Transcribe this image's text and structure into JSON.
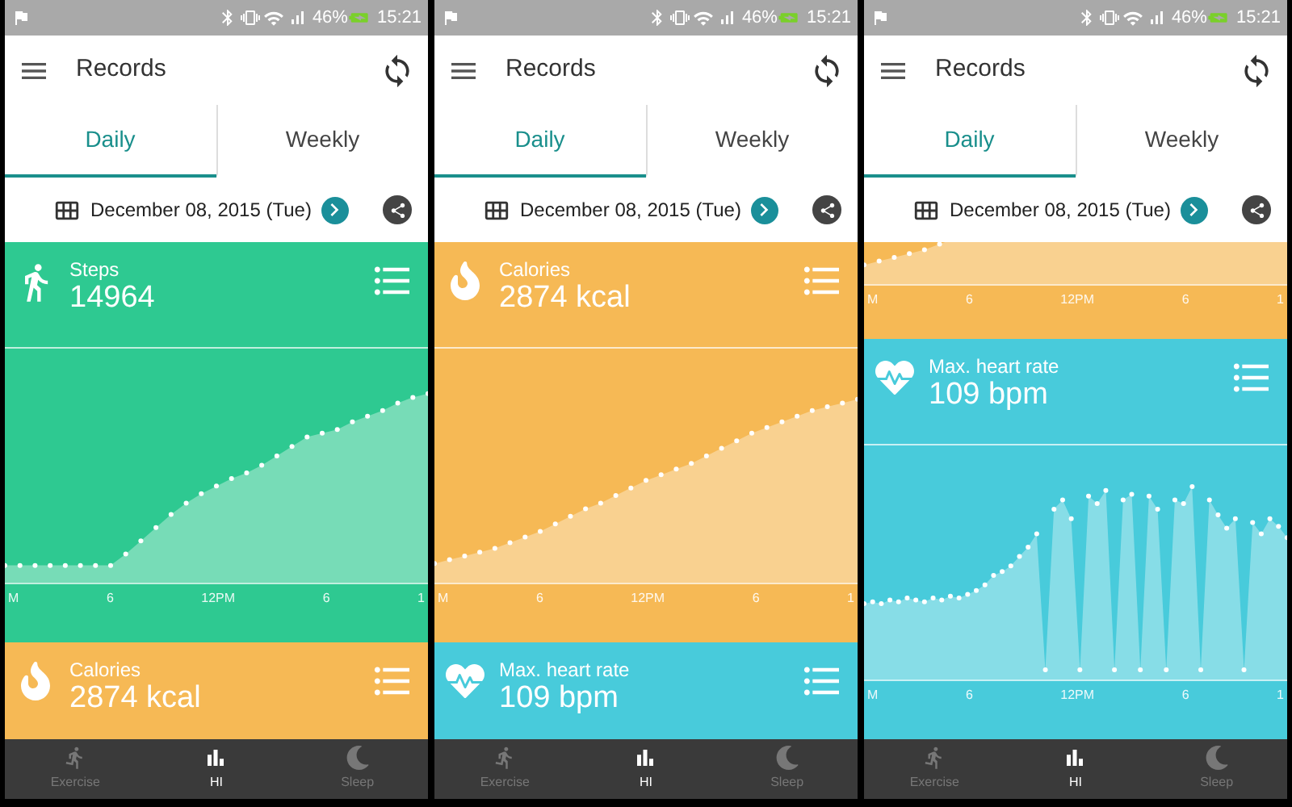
{
  "phones": [
    {
      "status_bar": {
        "battery": "46%",
        "time": "15:21"
      },
      "title": "Records",
      "tabs": [
        {
          "label": "Daily",
          "selected": true
        },
        {
          "label": "Weekly",
          "selected": false
        }
      ],
      "date": "December 08, 2015 (Tue)",
      "cards": [
        {
          "kind": "steps",
          "label": "Steps",
          "value": "14964",
          "color": "#2ec991",
          "x_labels": [
            "M",
            "6",
            "12PM",
            "6",
            "1"
          ]
        },
        {
          "kind": "calories",
          "label": "Calories",
          "value": "2874 kcal",
          "color": "#f6b955"
        }
      ],
      "nav": [
        {
          "kind": "exercise",
          "label": "Exercise",
          "selected": false
        },
        {
          "kind": "stats",
          "label": "HI",
          "selected": true
        },
        {
          "kind": "sleep",
          "label": "Sleep",
          "selected": false
        }
      ]
    },
    {
      "status_bar": {
        "battery": "46%",
        "time": "15:21"
      },
      "title": "Records",
      "tabs": [
        {
          "label": "Daily",
          "selected": true
        },
        {
          "label": "Weekly",
          "selected": false
        }
      ],
      "date": "December 08, 2015 (Tue)",
      "cards": [
        {
          "kind": "calories",
          "label": "Calories",
          "value": "2874 kcal",
          "color": "#f6b955",
          "x_labels": [
            "M",
            "6",
            "12PM",
            "6",
            "1"
          ]
        },
        {
          "kind": "heart",
          "label": "Max. heart rate",
          "value": "109 bpm",
          "color": "#48cbdb"
        }
      ],
      "nav": [
        {
          "kind": "exercise",
          "label": "Exercise",
          "selected": false
        },
        {
          "kind": "stats",
          "label": "HI",
          "selected": true
        },
        {
          "kind": "sleep",
          "label": "Sleep",
          "selected": false
        }
      ]
    },
    {
      "status_bar": {
        "battery": "46%",
        "time": "15:21"
      },
      "title": "Records",
      "tabs": [
        {
          "label": "Daily",
          "selected": true
        },
        {
          "label": "Weekly",
          "selected": false
        }
      ],
      "date": "December 08, 2015 (Tue)",
      "cards": [
        {
          "kind": "calories",
          "color": "#f6b955",
          "x_labels": [
            "M",
            "6",
            "12PM",
            "6",
            "1"
          ]
        },
        {
          "kind": "heart",
          "label": "Max. heart rate",
          "value": "109 bpm",
          "color": "#48cbdb",
          "x_labels": [
            "M",
            "6",
            "12PM",
            "6",
            "1"
          ]
        }
      ],
      "nav": [
        {
          "kind": "exercise",
          "label": "Exercise",
          "selected": false
        },
        {
          "kind": "stats",
          "label": "HI",
          "selected": true
        },
        {
          "kind": "sleep",
          "label": "Sleep",
          "selected": false
        }
      ]
    }
  ]
}
